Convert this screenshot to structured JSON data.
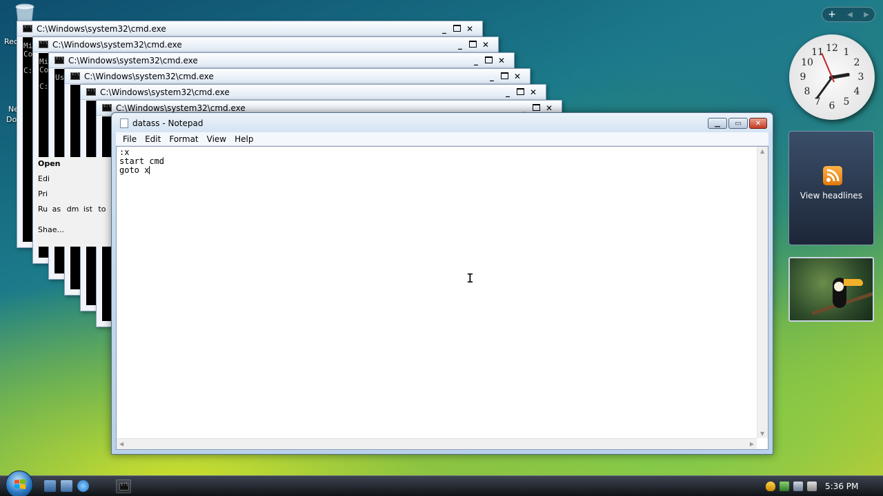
{
  "desktop": {
    "labels": [
      "Rec",
      "Ne",
      "Do"
    ]
  },
  "cmd_windows": [
    {
      "title": "C:\\Windows\\system32\\cmd.exe",
      "peek": "Mi\nCo\n\nC:"
    },
    {
      "title": "C:\\Windows\\system32\\cmd.exe",
      "peek": "Mi\nCo\n\nC:"
    },
    {
      "title": "C:\\Windows\\system32\\cmd.exe",
      "peek": "Us"
    },
    {
      "title": "C:\\Windows\\system32\\cmd.exe",
      "peek": ""
    },
    {
      "title": "C:\\Windows\\system32\\cmd.exe",
      "peek": ""
    },
    {
      "title": "C:\\Windows\\system32\\cmd.exe",
      "peek": ""
    }
  ],
  "context_menu": [
    "Open",
    "Edi",
    "Pri",
    "Ru",
    "as",
    "dm",
    "ist",
    "to",
    "Sha",
    "e..."
  ],
  "notepad": {
    "title": "datass - Notepad",
    "menu": [
      "File",
      "Edit",
      "Format",
      "View",
      "Help"
    ],
    "content": ":x\nstart cmd\ngoto x"
  },
  "sidebar": {
    "add_label": "+",
    "feed_label": "View headlines",
    "clock_numbers": [
      "12",
      "1",
      "2",
      "3",
      "4",
      "5",
      "6",
      "7",
      "8",
      "9",
      "10",
      "11"
    ]
  },
  "taskbar": {
    "time": "5:36 PM"
  },
  "colors": {
    "close_red": "#c43c24",
    "rss_orange": "#e0780a",
    "clock_second_hand": "#c0242a"
  }
}
